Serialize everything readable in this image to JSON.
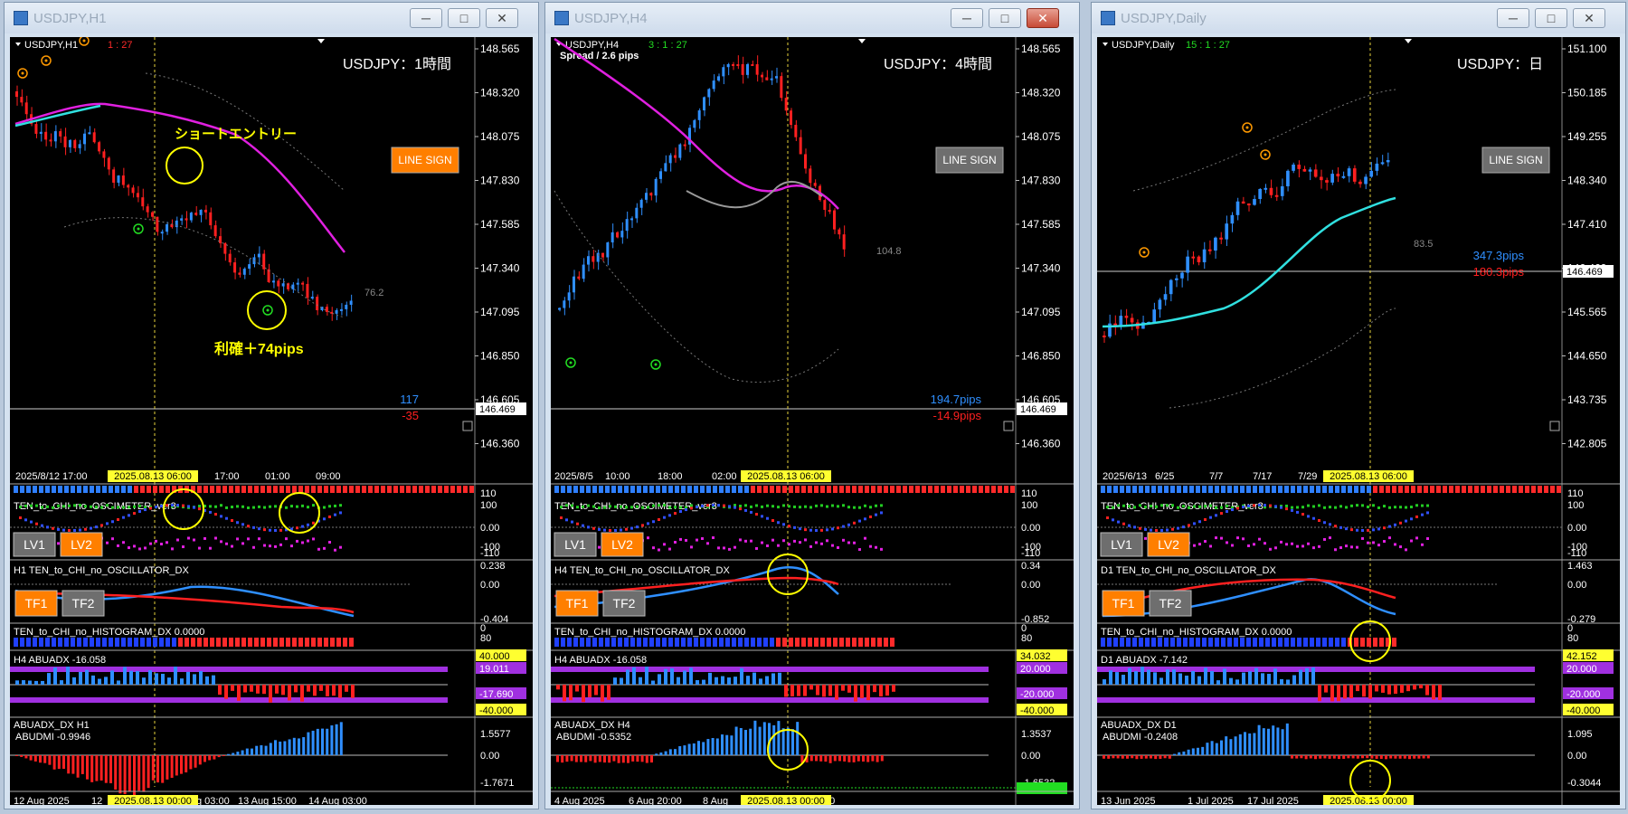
{
  "windows": [
    {
      "title": "USDJPY,H1",
      "symbol": "USDJPY,H1",
      "counter": "1 : 27",
      "counter_color": "#ff2a2a",
      "spread": "",
      "header": "USDJPY：1時間",
      "line_sign": "LINE SIGN",
      "line_sign_color": "#ff7f00",
      "price_labels": [
        "148.565",
        "148.320",
        "148.075",
        "147.830",
        "147.585",
        "147.340",
        "147.095",
        "146.850",
        "146.605",
        "146.360"
      ],
      "current_price": "146.469",
      "blue_value": "117",
      "red_value": "-35",
      "mid_value": "76.2",
      "time_labels": [
        "2025/8/12 17:00",
        "17:00",
        "01:00",
        "09:00"
      ],
      "time_highlight": "2025.08.13 06:00",
      "bottom_time_labels": [
        "12 Aug 2025",
        "12",
        "g 03:00",
        "13 Aug 15:00",
        "14 Aug 03:00"
      ],
      "bottom_time_highlight": "2025.08.13 00:00",
      "annotations": [
        {
          "text": "ショートエントリー",
          "color": "#ffff00"
        },
        {
          "text": "利確＋74pips",
          "color": "#ffff00"
        }
      ],
      "oscimeter": {
        "title": "TEN_to_CHI_no_OSCIMETER_ver3",
        "scale": [
          "110",
          "100",
          "0.00",
          "-100",
          "-110"
        ],
        "buttons": [
          "LV1",
          "LV2"
        ]
      },
      "oscillator": {
        "title": "H1  TEN_to_CHI_no_OSCILLATOR_DX",
        "scale": [
          "0.238",
          "0.00",
          "-0.404"
        ],
        "buttons": [
          "TF1",
          "TF2"
        ]
      },
      "histogram": {
        "title": "TEN_to_CHI_no_HISTOGRAM_DX 0.0000",
        "scale": [
          "0",
          "80"
        ]
      },
      "abuadx": {
        "title": "H4  ABUADX  -16.058",
        "scale": [
          "40.000",
          "19.011",
          "-17.690",
          "-40.000"
        ]
      },
      "abudmi_title": "ABUADX_DX H1",
      "abudmi": {
        "title": "ABUDMI  -0.9946",
        "scale": [
          "1.5577",
          "0.00",
          "-1.7671"
        ]
      }
    },
    {
      "title": "USDJPY,H4",
      "symbol": "USDJPY,H4",
      "counter": "3 : 1 : 27",
      "counter_color": "#22dd22",
      "spread": "Spread / 2.6 pips",
      "header": "USDJPY：4時間",
      "line_sign": "LINE SIGN",
      "line_sign_color": "#6e6e6e",
      "price_labels": [
        "148.565",
        "148.320",
        "148.075",
        "147.830",
        "147.585",
        "147.340",
        "147.095",
        "146.850",
        "146.605",
        "146.360"
      ],
      "current_price": "146.469",
      "blue_value": "194.7pips",
      "red_value": "-14.9pips",
      "mid_value": "104.8",
      "time_labels": [
        "2025/8/5",
        "10:00",
        "18:00",
        "02:00"
      ],
      "time_highlight": "2025.08.13 06:00",
      "bottom_time_labels": [
        "4 Aug 2025",
        "6 Aug 20:00",
        "8 Aug",
        "00"
      ],
      "bottom_time_highlight": "2025.08.13 00:00",
      "annotations": [],
      "oscimeter": {
        "title": "TEN_to_CHI_no_OSCIMETER_ver3",
        "scale": [
          "110",
          "100",
          "0.00",
          "-100",
          "-110"
        ],
        "buttons": [
          "LV1",
          "LV2"
        ]
      },
      "oscillator": {
        "title": "H4  TEN_to_CHI_no_OSCILLATOR_DX",
        "scale": [
          "0.34",
          "0.00",
          "-0.852"
        ],
        "buttons": [
          "TF1",
          "TF2"
        ]
      },
      "histogram": {
        "title": "TEN_to_CHI_no_HISTOGRAM_DX 0.0000",
        "scale": [
          "0",
          "80"
        ]
      },
      "abuadx": {
        "title": "H4  ABUADX  -16.058",
        "scale": [
          "34.032",
          "20.000",
          "-20.000",
          "-40.000"
        ]
      },
      "abudmi_title": "ABUADX_DX H4",
      "abudmi": {
        "title": "ABUDMI  -0.5352",
        "scale": [
          "1.3537",
          "0.00",
          "-1.6532"
        ]
      }
    },
    {
      "title": "USDJPY,Daily",
      "symbol": "USDJPY,Daily",
      "counter": "15 : 1 : 27",
      "counter_color": "#22dd22",
      "spread": "",
      "header": "USDJPY：日",
      "line_sign": "LINE SIGN",
      "line_sign_color": "#6e6e6e",
      "price_labels": [
        "151.100",
        "150.185",
        "149.255",
        "148.340",
        "147.410",
        "146.469",
        "145.565",
        "144.650",
        "143.735",
        "142.805"
      ],
      "current_price": "146.469",
      "blue_value": "347.3pips",
      "red_value": "180.3pips",
      "mid_value": "83.5",
      "time_labels": [
        "2025/6/13",
        "6/25",
        "7/7",
        "7/17",
        "7/29"
      ],
      "time_highlight": "2025.08.13 06:00",
      "bottom_time_labels": [
        "13 Jun 2025",
        "1 Jul 2025",
        "17 Jul 2025"
      ],
      "bottom_time_highlight": "2025.08.13 00:00",
      "annotations": [],
      "oscimeter": {
        "title": "TEN_to_CHI_no_OSCIMETER_ver3",
        "scale": [
          "110",
          "100",
          "0.00",
          "-100",
          "-110"
        ],
        "buttons": [
          "LV1",
          "LV2"
        ]
      },
      "oscillator": {
        "title": "D1  TEN_to_CHI_no_OSCILLATOR_DX",
        "scale": [
          "1.463",
          "0.00",
          "-0.279"
        ],
        "buttons": [
          "TF1",
          "TF2"
        ]
      },
      "histogram": {
        "title": "TEN_to_CHI_no_HISTOGRAM_DX 0.0000",
        "scale": [
          "0",
          "80"
        ]
      },
      "abuadx": {
        "title": "D1  ABUADX  -7.142",
        "scale": [
          "42.152",
          "20.000",
          "-20.000",
          "-40.000"
        ]
      },
      "abudmi_title": "ABUADX_DX D1",
      "abudmi": {
        "title": "ABUDMI  -0.2408",
        "scale": [
          "1.095",
          "0.00",
          "-0.3044"
        ]
      }
    }
  ]
}
